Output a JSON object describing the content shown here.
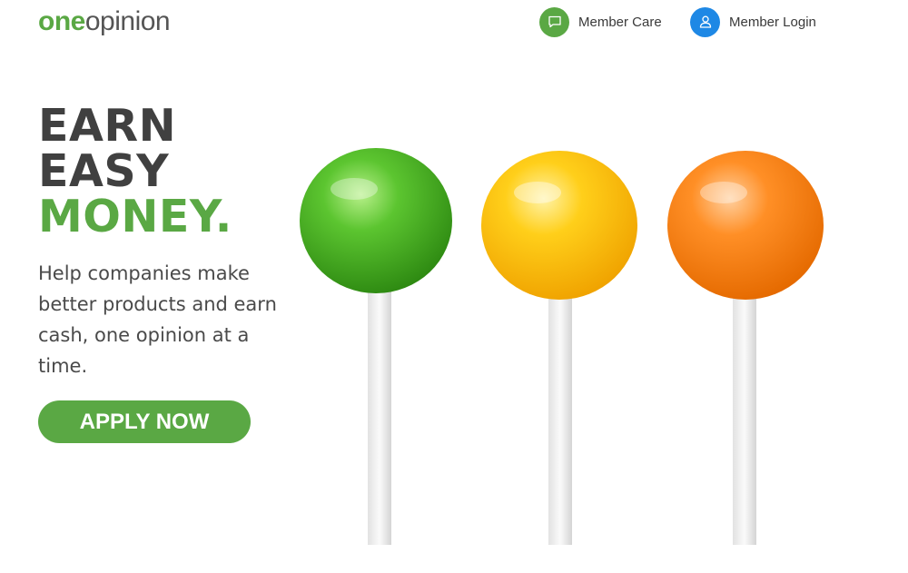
{
  "header": {
    "logo": {
      "part1": "one",
      "part2": "opinion"
    },
    "nav": [
      {
        "label": "Member Care",
        "icon": "chat-bubble-icon",
        "color": "#5aa844"
      },
      {
        "label": "Member Login",
        "icon": "user-icon",
        "color": "#1e88e5"
      }
    ]
  },
  "hero": {
    "headline": {
      "line1": "EARN",
      "line2": "EASY",
      "line3": "MONEY."
    },
    "subtext": "Help companies make better products and earn cash, one opinion at a time.",
    "cta_label": "APPLY NOW",
    "image": "lollipops"
  },
  "colors": {
    "brand_green": "#5aa844",
    "heading_gray": "#404040",
    "login_blue": "#1e88e5",
    "lollipop_green": "#4db326",
    "lollipop_yellow": "#ffc20e",
    "lollipop_orange": "#ff8a1f"
  }
}
